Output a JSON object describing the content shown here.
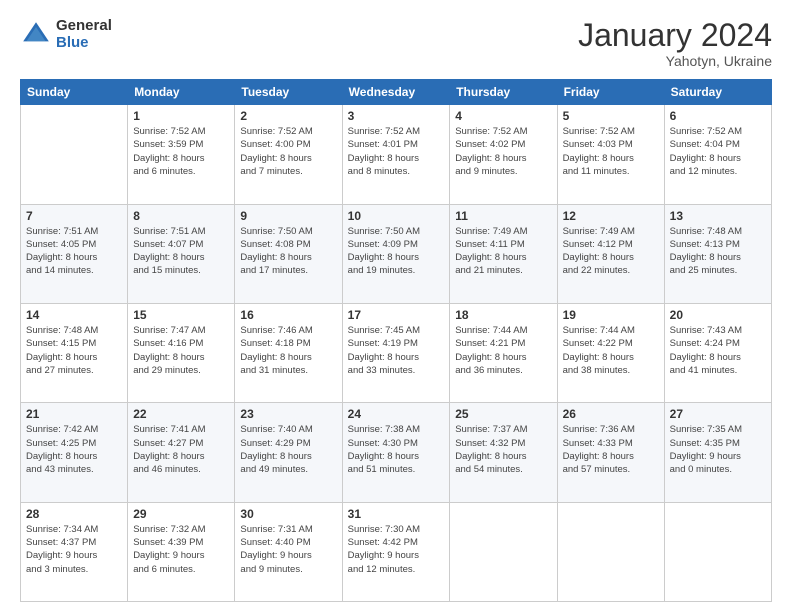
{
  "header": {
    "logo_general": "General",
    "logo_blue": "Blue",
    "month_year": "January 2024",
    "location": "Yahotyn, Ukraine"
  },
  "columns": [
    "Sunday",
    "Monday",
    "Tuesday",
    "Wednesday",
    "Thursday",
    "Friday",
    "Saturday"
  ],
  "weeks": [
    [
      {
        "day": "",
        "info": ""
      },
      {
        "day": "1",
        "info": "Sunrise: 7:52 AM\nSunset: 3:59 PM\nDaylight: 8 hours\nand 6 minutes."
      },
      {
        "day": "2",
        "info": "Sunrise: 7:52 AM\nSunset: 4:00 PM\nDaylight: 8 hours\nand 7 minutes."
      },
      {
        "day": "3",
        "info": "Sunrise: 7:52 AM\nSunset: 4:01 PM\nDaylight: 8 hours\nand 8 minutes."
      },
      {
        "day": "4",
        "info": "Sunrise: 7:52 AM\nSunset: 4:02 PM\nDaylight: 8 hours\nand 9 minutes."
      },
      {
        "day": "5",
        "info": "Sunrise: 7:52 AM\nSunset: 4:03 PM\nDaylight: 8 hours\nand 11 minutes."
      },
      {
        "day": "6",
        "info": "Sunrise: 7:52 AM\nSunset: 4:04 PM\nDaylight: 8 hours\nand 12 minutes."
      }
    ],
    [
      {
        "day": "7",
        "info": "Sunrise: 7:51 AM\nSunset: 4:05 PM\nDaylight: 8 hours\nand 14 minutes."
      },
      {
        "day": "8",
        "info": "Sunrise: 7:51 AM\nSunset: 4:07 PM\nDaylight: 8 hours\nand 15 minutes."
      },
      {
        "day": "9",
        "info": "Sunrise: 7:50 AM\nSunset: 4:08 PM\nDaylight: 8 hours\nand 17 minutes."
      },
      {
        "day": "10",
        "info": "Sunrise: 7:50 AM\nSunset: 4:09 PM\nDaylight: 8 hours\nand 19 minutes."
      },
      {
        "day": "11",
        "info": "Sunrise: 7:49 AM\nSunset: 4:11 PM\nDaylight: 8 hours\nand 21 minutes."
      },
      {
        "day": "12",
        "info": "Sunrise: 7:49 AM\nSunset: 4:12 PM\nDaylight: 8 hours\nand 22 minutes."
      },
      {
        "day": "13",
        "info": "Sunrise: 7:48 AM\nSunset: 4:13 PM\nDaylight: 8 hours\nand 25 minutes."
      }
    ],
    [
      {
        "day": "14",
        "info": "Sunrise: 7:48 AM\nSunset: 4:15 PM\nDaylight: 8 hours\nand 27 minutes."
      },
      {
        "day": "15",
        "info": "Sunrise: 7:47 AM\nSunset: 4:16 PM\nDaylight: 8 hours\nand 29 minutes."
      },
      {
        "day": "16",
        "info": "Sunrise: 7:46 AM\nSunset: 4:18 PM\nDaylight: 8 hours\nand 31 minutes."
      },
      {
        "day": "17",
        "info": "Sunrise: 7:45 AM\nSunset: 4:19 PM\nDaylight: 8 hours\nand 33 minutes."
      },
      {
        "day": "18",
        "info": "Sunrise: 7:44 AM\nSunset: 4:21 PM\nDaylight: 8 hours\nand 36 minutes."
      },
      {
        "day": "19",
        "info": "Sunrise: 7:44 AM\nSunset: 4:22 PM\nDaylight: 8 hours\nand 38 minutes."
      },
      {
        "day": "20",
        "info": "Sunrise: 7:43 AM\nSunset: 4:24 PM\nDaylight: 8 hours\nand 41 minutes."
      }
    ],
    [
      {
        "day": "21",
        "info": "Sunrise: 7:42 AM\nSunset: 4:25 PM\nDaylight: 8 hours\nand 43 minutes."
      },
      {
        "day": "22",
        "info": "Sunrise: 7:41 AM\nSunset: 4:27 PM\nDaylight: 8 hours\nand 46 minutes."
      },
      {
        "day": "23",
        "info": "Sunrise: 7:40 AM\nSunset: 4:29 PM\nDaylight: 8 hours\nand 49 minutes."
      },
      {
        "day": "24",
        "info": "Sunrise: 7:38 AM\nSunset: 4:30 PM\nDaylight: 8 hours\nand 51 minutes."
      },
      {
        "day": "25",
        "info": "Sunrise: 7:37 AM\nSunset: 4:32 PM\nDaylight: 8 hours\nand 54 minutes."
      },
      {
        "day": "26",
        "info": "Sunrise: 7:36 AM\nSunset: 4:33 PM\nDaylight: 8 hours\nand 57 minutes."
      },
      {
        "day": "27",
        "info": "Sunrise: 7:35 AM\nSunset: 4:35 PM\nDaylight: 9 hours\nand 0 minutes."
      }
    ],
    [
      {
        "day": "28",
        "info": "Sunrise: 7:34 AM\nSunset: 4:37 PM\nDaylight: 9 hours\nand 3 minutes."
      },
      {
        "day": "29",
        "info": "Sunrise: 7:32 AM\nSunset: 4:39 PM\nDaylight: 9 hours\nand 6 minutes."
      },
      {
        "day": "30",
        "info": "Sunrise: 7:31 AM\nSunset: 4:40 PM\nDaylight: 9 hours\nand 9 minutes."
      },
      {
        "day": "31",
        "info": "Sunrise: 7:30 AM\nSunset: 4:42 PM\nDaylight: 9 hours\nand 12 minutes."
      },
      {
        "day": "",
        "info": ""
      },
      {
        "day": "",
        "info": ""
      },
      {
        "day": "",
        "info": ""
      }
    ]
  ]
}
